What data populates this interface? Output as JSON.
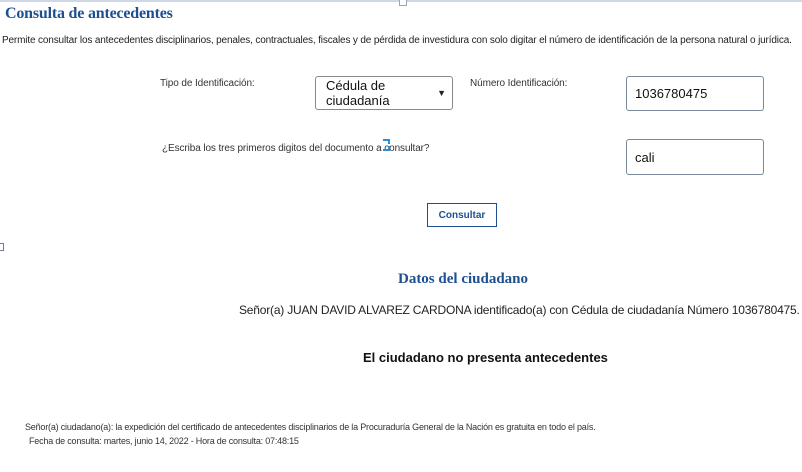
{
  "page": {
    "title": "Consulta de antecedentes",
    "description": "Permite consultar los antecedentes disciplinarios, penales, contractuales, fiscales y de pérdida de investidura con solo digitar el número de identificación de la persona natural o jurídica."
  },
  "form": {
    "id_type_label": "Tipo de Identificación:",
    "id_type_value": "Cédula de ciudadanía",
    "id_number_label": "Número Identificación:",
    "id_number_value": "1036780475",
    "question_label": "¿Escriba los tres primeros digitos del documento a consultar?",
    "answer_value": "cali",
    "submit_label": "Consultar"
  },
  "result": {
    "section_title": "Datos del ciudadano",
    "citizen_line": "Señor(a)  JUAN DAVID ALVAREZ CARDONA identificado(a) con Cédula de ciudadanía Número 1036780475.",
    "status": "El ciudadano no presenta antecedentes"
  },
  "footer": {
    "notice": "Señor(a) ciudadano(a): la expedición del certificado de antecedentes disciplinarios de la Procuraduría General de la Nación es gratuita en todo el país.",
    "consult_date": "Fecha de consulta: martes, junio 14, 2022 - Hora de consulta: 07:48:15"
  },
  "icons": {
    "select_arrow": "chevron-down-icon",
    "refresh": "refresh-icon"
  },
  "colors": {
    "accent": "#1d4f91",
    "refresh_icon": "#2a8fd6"
  }
}
